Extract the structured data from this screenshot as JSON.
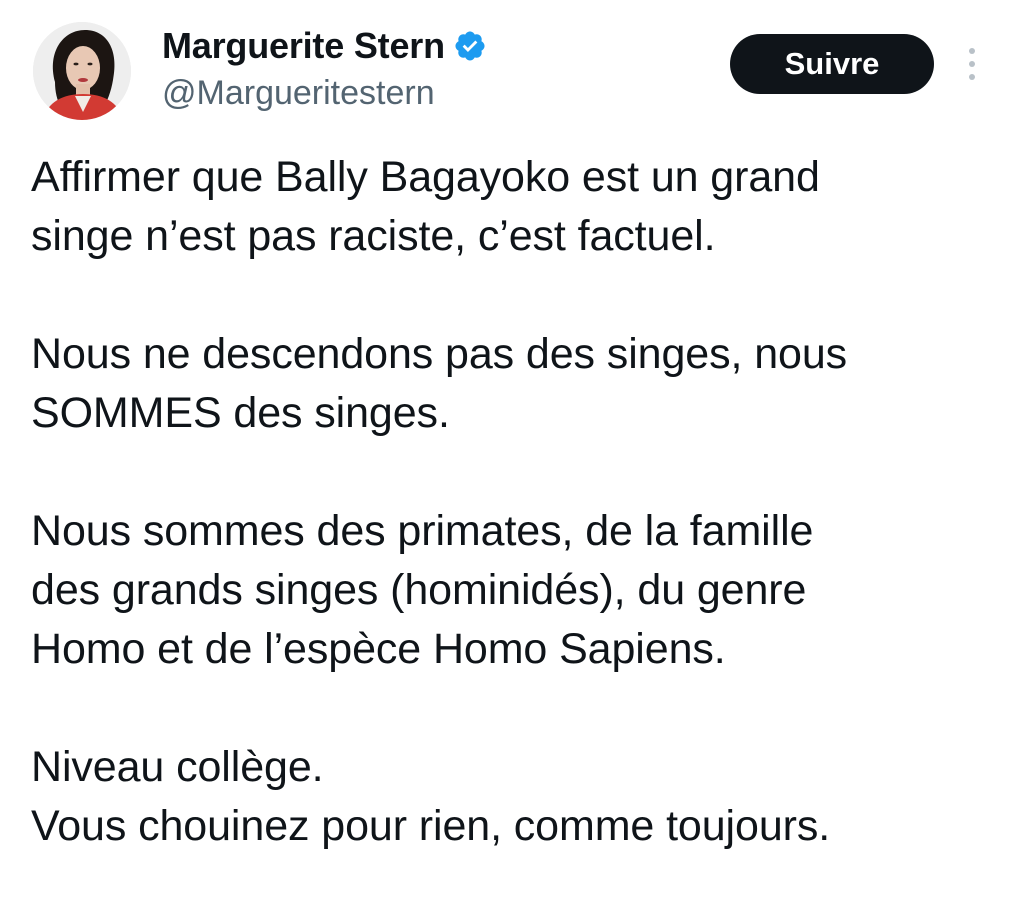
{
  "author": {
    "display_name": "Marguerite Stern",
    "handle": "@Margueritestern",
    "verified": true,
    "verified_color": "#1d9bf0",
    "avatar_icon": "profile-photo"
  },
  "actions": {
    "follow_label": "Suivre",
    "more_icon": "more-vertical-icon"
  },
  "tweet": {
    "paragraphs": [
      {
        "lines": [
          "Affirmer que Bally Bagayoko est un grand",
          "singe n’est pas raciste, c’est factuel."
        ]
      },
      {
        "lines": [
          "Nous ne descendons pas des singes, nous",
          "SOMMES des singes."
        ]
      },
      {
        "lines": [
          "Nous sommes des primates, de la famille",
          "des grands singes (hominidés), du genre",
          "Homo et de l’espèce Homo Sapiens."
        ]
      },
      {
        "lines": [
          "Niveau collège.",
          "Vous chouinez pour rien, comme toujours."
        ]
      }
    ]
  },
  "colors": {
    "text_primary": "#0f1419",
    "text_secondary": "#536471",
    "button_bg": "#0f1419",
    "button_text": "#ffffff"
  }
}
